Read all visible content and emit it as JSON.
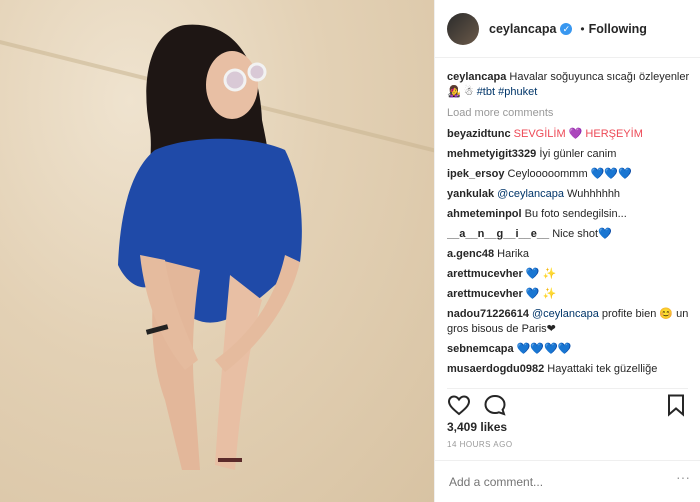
{
  "header": {
    "username": "ceylancapa",
    "verified_glyph": "✓",
    "separator": "•",
    "follow_state": "Following"
  },
  "caption": {
    "username": "ceylancapa",
    "text": "Havalar soğuyunca sıcağı özleyenler",
    "emoji": "👩‍🎤 ☃",
    "tags": [
      "#tbt",
      "#phuket"
    ]
  },
  "load_more": "Load more comments",
  "comments": [
    {
      "user": "beyazidtunc",
      "text": "SEVGİLİM 💜 HERŞEYİM",
      "accent": "red"
    },
    {
      "user": "mehmetyigit3329",
      "text": "İyi günler canim"
    },
    {
      "user": "ipek_ersoy",
      "text": "Ceylooooommm 💙💙💙"
    },
    {
      "user": "yankulak",
      "mention": "@ceylancapa",
      "text": " Wuhhhhhh"
    },
    {
      "user": "ahmeteminpol",
      "text": "Bu foto sendegilsin..."
    },
    {
      "user": "__a__n__g__i__e__",
      "text": "Nice shot💙"
    },
    {
      "user": "a.genc48",
      "text": "Harika"
    },
    {
      "user": "arettmucevher",
      "text": "💙 ✨"
    },
    {
      "user": "arettmucevher",
      "text": "💙 ✨"
    },
    {
      "user": "nadou71226614",
      "mention": "@ceylancapa",
      "text": " profite bien 😊 un gros bisous de Paris❤"
    },
    {
      "user": "sebnemcapa",
      "text": "💙💙💙💙"
    },
    {
      "user": "musaerdogdu0982",
      "text": "Hayattaki tek güzelliğe"
    }
  ],
  "actions": {
    "like_icon": "heart-outline-icon",
    "comment_icon": "comment-bubble-icon",
    "save_icon": "bookmark-icon"
  },
  "likes": "3,409 likes",
  "time": "14 HOURS AGO",
  "add_comment_placeholder": "Add a comment...",
  "more_glyph": "···",
  "colors": {
    "accent": "#3897f0",
    "text": "#262626",
    "muted": "#999999",
    "hashtag": "#003569",
    "border": "#efefef"
  }
}
